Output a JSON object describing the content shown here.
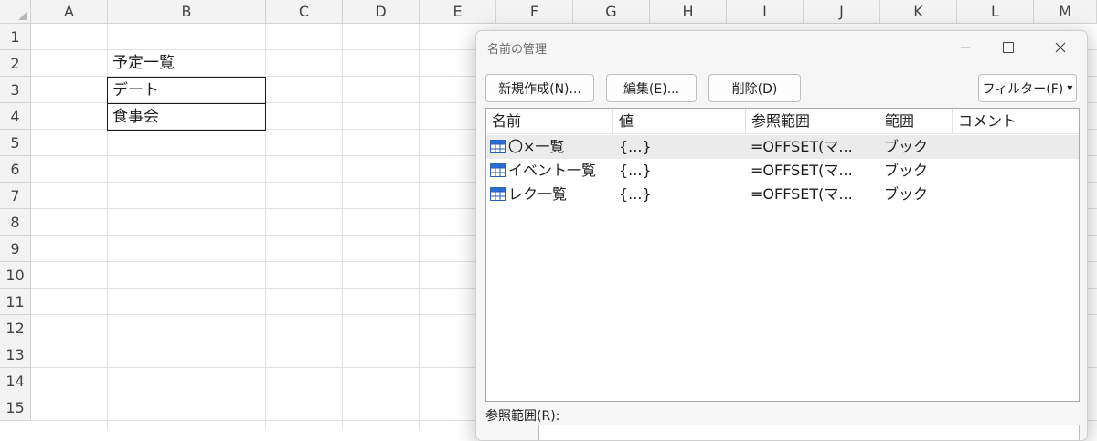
{
  "sheet": {
    "columns": [
      "A",
      "B",
      "C",
      "D",
      "E",
      "F",
      "G",
      "H",
      "I",
      "J",
      "K",
      "L",
      "M"
    ],
    "rows": [
      "1",
      "2",
      "3",
      "4",
      "5",
      "6",
      "7",
      "8",
      "9",
      "10",
      "11",
      "12",
      "13",
      "14",
      "15"
    ],
    "cells": {
      "B2": "予定一覧",
      "B3": "デート",
      "B4": "食事会"
    }
  },
  "dialog": {
    "title": "名前の管理",
    "buttons": {
      "new": "新規作成(N)...",
      "edit": "編集(E)...",
      "delete": "削除(D)",
      "filter": "フィルター(F)"
    },
    "columns": [
      "名前",
      "値",
      "参照範囲",
      "範囲",
      "コメント"
    ],
    "rows": [
      {
        "name": "〇×一覧",
        "value": "{...}",
        "refers": "=OFFSET(マ...",
        "scope": "ブック",
        "comment": ""
      },
      {
        "name": "イベント一覧",
        "value": "{...}",
        "refers": "=OFFSET(マ...",
        "scope": "ブック",
        "comment": ""
      },
      {
        "name": "レク一覧",
        "value": "{...}",
        "refers": "=OFFSET(マ...",
        "scope": "ブック",
        "comment": ""
      }
    ],
    "refers_to_label": "参照範囲(R):",
    "icons": {
      "name_row": "table-icon",
      "minimize": "minimize-icon",
      "maximize": "maximize-icon",
      "close": "close-icon",
      "filter": "dropdown-arrow-icon"
    }
  }
}
